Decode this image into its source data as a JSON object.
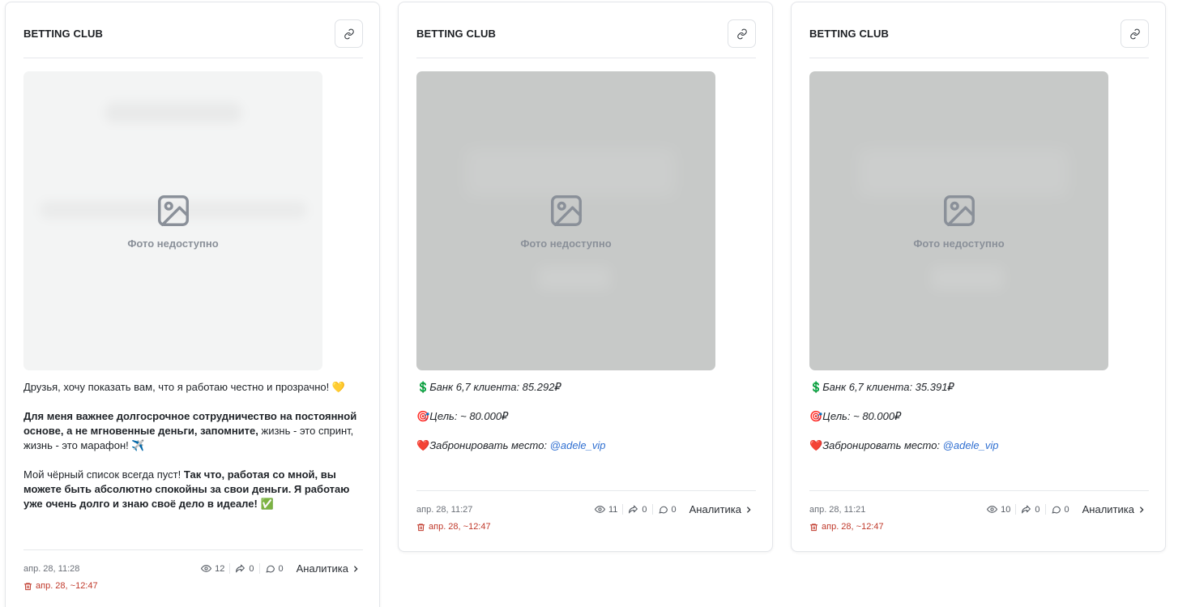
{
  "colors": {
    "accent_link": "#2f6fd1",
    "danger": "#c0392b"
  },
  "posts": [
    {
      "channel": "BETTING CLUB",
      "photo_label": "Фото недоступно",
      "text": {
        "p1": "Друзья, хочу показать вам, что я работаю честно и прозрачно!",
        "p1_emoji": "💛",
        "p2_bold": "Для меня важнее долгосрочное сотрудничество на постоянной основе, а не мгновенные деньги, запомните,",
        "p2_rest": " жизнь - это спринт, жизнь - это марафон!",
        "p2_emoji": "✈️",
        "p3_start": "Мой чёрный список всегда пуст! ",
        "p3_bold": "Так что, работая со мной, вы можете быть абсолютно спокойны за свои деньги. Я работаю уже очень долго и знаю своё дело в идеале!",
        "p3_emoji": "✅"
      },
      "time": "апр. 28, 11:28",
      "delete_time": "апр. 28, ~12:47",
      "views": "12",
      "shares": "0",
      "comments": "0",
      "analytics": "Аналитика"
    },
    {
      "channel": "BETTING CLUB",
      "photo_label": "Фото недоступно",
      "text": {
        "l1_emoji": "💲",
        "l1": "Банк 6,7 клиента: 85.292₽",
        "l2_emoji": "🎯",
        "l2": "Цель: ~ 80.000₽",
        "l3_emoji": "❤️",
        "l3": "Забронировать место: ",
        "l3_link": "@adele_vip"
      },
      "time": "апр. 28, 11:27",
      "delete_time": "апр. 28, ~12:47",
      "views": "11",
      "shares": "0",
      "comments": "0",
      "analytics": "Аналитика"
    },
    {
      "channel": "BETTING CLUB",
      "photo_label": "Фото недоступно",
      "text": {
        "l1_emoji": "💲",
        "l1": "Банк 6,7 клиента: 35.391₽",
        "l2_emoji": "🎯",
        "l2": "Цель: ~ 80.000₽",
        "l3_emoji": "❤️",
        "l3": "Забронировать место: ",
        "l3_link": "@adele_vip"
      },
      "time": "апр. 28, 11:21",
      "delete_time": "апр. 28, ~12:47",
      "views": "10",
      "shares": "0",
      "comments": "0",
      "analytics": "Аналитика"
    }
  ]
}
